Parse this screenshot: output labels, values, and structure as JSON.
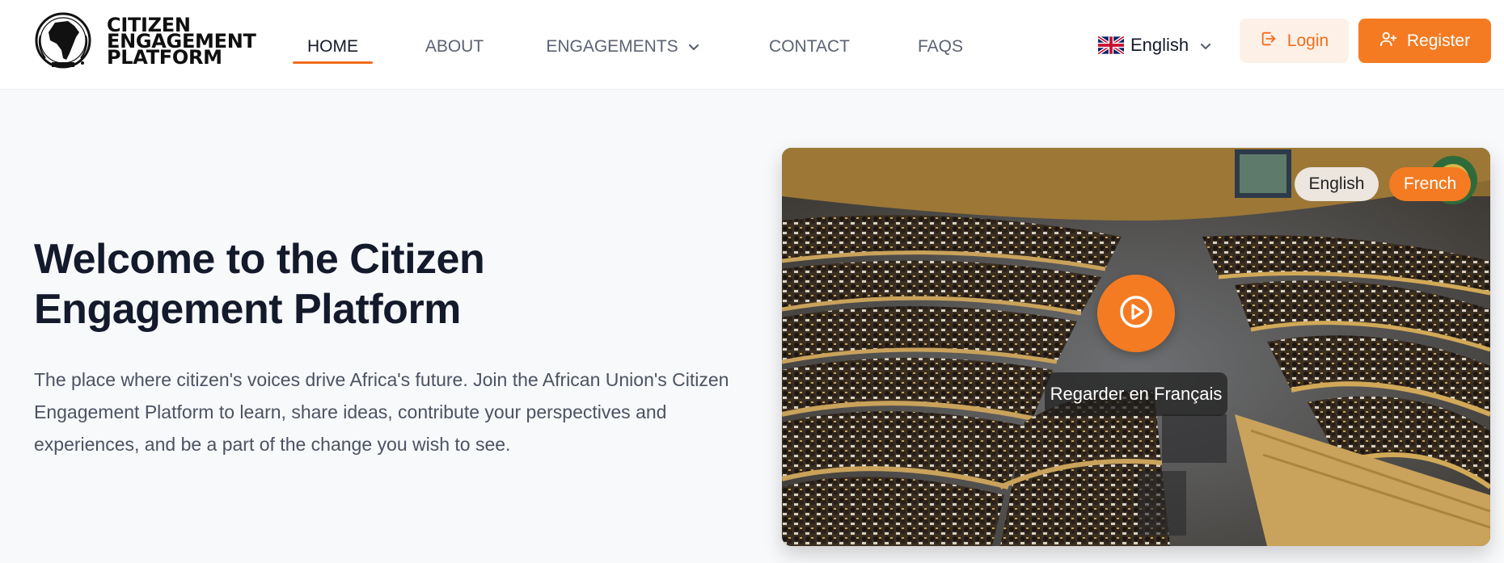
{
  "logo": {
    "line1": "CITIZEN",
    "line2": "ENGAGEMENT",
    "line3": "PLATFORM",
    "icon": "african-union-emblem"
  },
  "nav": {
    "items": [
      {
        "label": "HOME",
        "active": true
      },
      {
        "label": "ABOUT"
      },
      {
        "label": "ENGAGEMENTS",
        "icon": "chevron-down-icon"
      },
      {
        "label": "CONTACT"
      },
      {
        "label": "FAQS"
      }
    ]
  },
  "language": {
    "selected": "English",
    "flag": "uk-flag-icon"
  },
  "auth": {
    "login_label": "Login",
    "register_label": "Register"
  },
  "hero": {
    "title": "Welcome to the Citizen Engagement Platform",
    "description": "The place where citizen's voices drive Africa's future. Join the African Union's Citizen Engagement Platform to learn, share ideas, contribute your perspectives and experiences, and be a part of the change you wish to see."
  },
  "video": {
    "language_options": [
      "English",
      "French"
    ],
    "selected_language": "French",
    "caption": "Regarder en Français",
    "play_icon": "play-circle-icon"
  },
  "colors": {
    "accent": "#f47b22",
    "accent_light": "#fdf0e6",
    "text_dark": "#131a2b",
    "text_muted": "#5b6273",
    "background": "#f8f9fb"
  }
}
